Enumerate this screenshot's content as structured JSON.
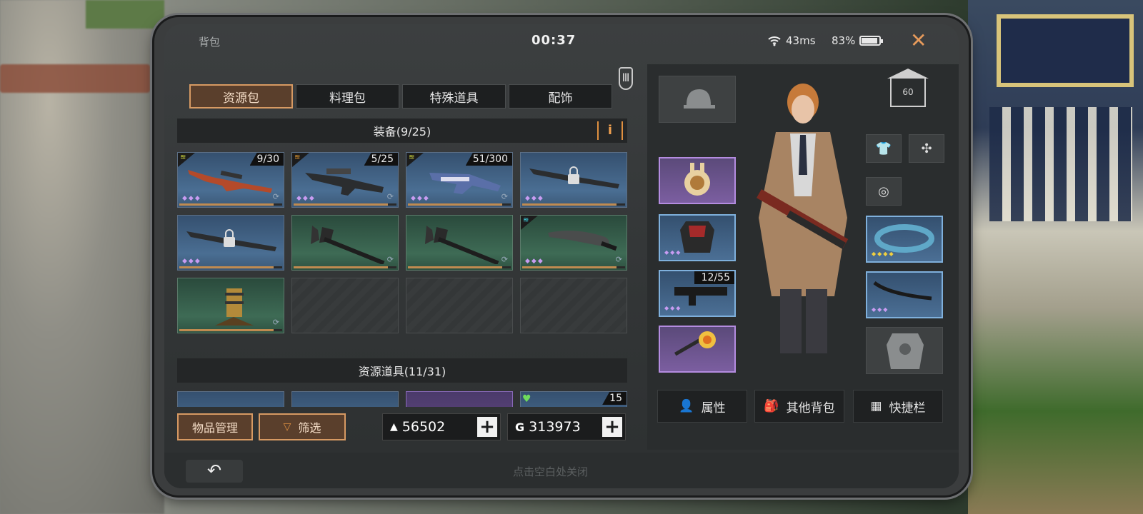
{
  "status": {
    "title": "背包",
    "clock": "00:37",
    "ping": "43ms",
    "battery": "83%"
  },
  "tabs": [
    {
      "label": "资源包",
      "active": true
    },
    {
      "label": "料理包"
    },
    {
      "label": "特殊道具"
    },
    {
      "label": "配饰"
    }
  ],
  "sections": {
    "equipment": "装备(9/25)",
    "resources": "资源道具(11/31)"
  },
  "equipment_slots": [
    {
      "rarity": "blue",
      "count": "9/30",
      "item": "red-sniper-rifle"
    },
    {
      "rarity": "blue",
      "count": "5/25",
      "item": "heavy-rifle"
    },
    {
      "rarity": "blue",
      "count": "51/300",
      "item": "blue-shotgun"
    },
    {
      "rarity": "blue",
      "count": "",
      "item": "locked-sniper-rifle"
    },
    {
      "rarity": "blue",
      "count": "",
      "item": "locked-sniper-rifle"
    },
    {
      "rarity": "green",
      "count": "",
      "item": "fire-axe"
    },
    {
      "rarity": "green",
      "count": "",
      "item": "fire-axe"
    },
    {
      "rarity": "green",
      "count": "",
      "item": "machete"
    },
    {
      "rarity": "green",
      "count": "",
      "item": "trap-device"
    },
    {
      "rarity": "empty"
    },
    {
      "rarity": "empty"
    },
    {
      "rarity": "empty"
    }
  ],
  "resource_slots": [
    {
      "rarity": "blue"
    },
    {
      "rarity": "blue"
    },
    {
      "rarity": "purple"
    },
    {
      "rarity": "blue",
      "count": "15"
    }
  ],
  "buttons": {
    "manage": "物品管理",
    "filter": "筛选"
  },
  "currency": {
    "gold": "56502",
    "coins": "313973",
    "gold_icon": "gold-bar-icon",
    "coin_icon": "g-coin-icon",
    "plus": "+"
  },
  "character": {
    "level": "60"
  },
  "equipment_panel": {
    "weapon_count": "12/55"
  },
  "bottom_buttons": {
    "attributes": "属性",
    "other_bags": "其他背包",
    "quickbar": "快捷栏"
  },
  "footer": {
    "hint": "点击空白处关闭"
  },
  "colors": {
    "accent": "#d79a63",
    "rare_blue": "#4a6e93",
    "uncommon_green": "#3e6b55",
    "epic_purple": "#7b5ea0"
  }
}
